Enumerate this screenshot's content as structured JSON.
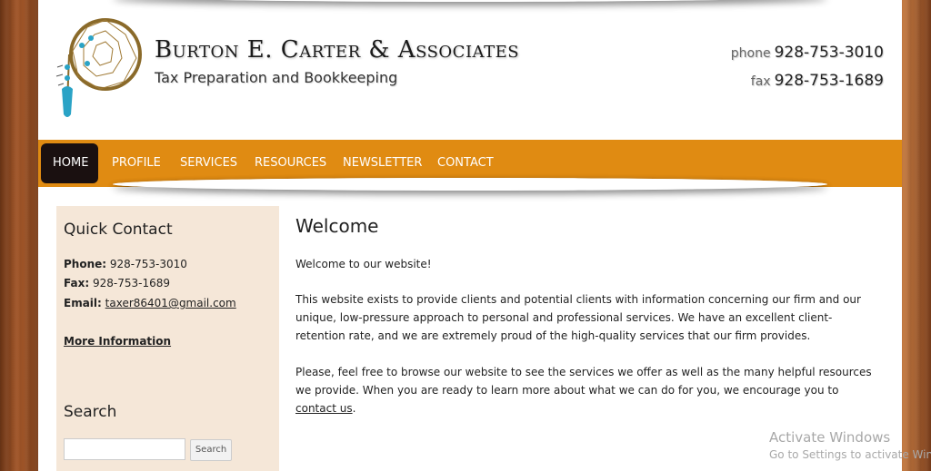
{
  "header": {
    "title": "Burton E. Carter & Associates",
    "subtitle": "Tax Preparation and Bookkeeping",
    "phone_label": "phone",
    "phone": "928-753-3010",
    "fax_label": "fax",
    "fax": "928-753-1689"
  },
  "nav": {
    "items": [
      {
        "label": "HOME",
        "active": true
      },
      {
        "label": "PROFILE"
      },
      {
        "label": "SERVICES"
      },
      {
        "label": "RESOURCES"
      },
      {
        "label": "NEWSLETTER"
      },
      {
        "label": "CONTACT"
      }
    ],
    "bg_color": "#e08b12",
    "active_color": "#1a1010"
  },
  "sidebar": {
    "quick_contact_title": "Quick Contact",
    "phone_label": "Phone:",
    "phone": "928-753-3010",
    "fax_label": "Fax:",
    "fax": "928-753-1689",
    "email_label": "Email:",
    "email": "taxer86401@gmail.com",
    "more_info": "More Information",
    "search_title": "Search",
    "search_button": "Search",
    "search_placeholder": ""
  },
  "main": {
    "heading": "Welcome",
    "intro": "Welcome to our website!",
    "para1": "This website exists to provide clients and potential clients with information concerning our firm and our unique, low-pressure approach to personal and professional services. We have an excellent client-retention rate, and we are extremely proud of the high-quality services that our firm provides.",
    "para2_a": "Please, feel free to browse our website to see the services we offer as well as the many helpful resources we provide. When you are ready to learn more about what we can do for you, we encourage you to ",
    "para2_link": "contact us",
    "para2_b": "."
  },
  "watermark": {
    "line1": "Activate Windows",
    "line2": "Go to Settings to activate Windows."
  }
}
